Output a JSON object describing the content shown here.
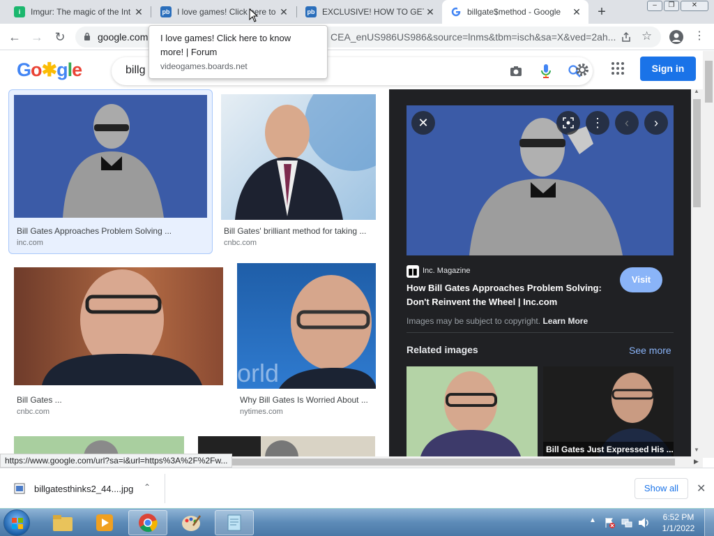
{
  "tabs": [
    {
      "label": "Imgur: The magic of the Int",
      "favicon": "imgur-icon"
    },
    {
      "label": "I love games! Click here to",
      "favicon": "proboards-icon"
    },
    {
      "label": "EXCLUSIVE! HOW TO GET F",
      "favicon": "proboards-icon"
    },
    {
      "label": "billgate$method - Google",
      "favicon": "google-icon",
      "active": true
    }
  ],
  "omnibox": {
    "host": "google.com",
    "tail": "CEA_enUS986US986&source=lnms&tbm=isch&sa=X&ved=2ah..."
  },
  "tooltip": {
    "title": "I love games! Click here to know more! | Forum",
    "host": "videogames.boards.net"
  },
  "header": {
    "logo_text": "Google",
    "query": "billg",
    "signin_label": "Sign in"
  },
  "results": [
    {
      "title": "Bill Gates Approaches Problem Solving ...",
      "source": "inc.com",
      "selected": true
    },
    {
      "title": "Bill Gates' brilliant method for taking ...",
      "source": "cnbc.com"
    },
    {
      "title": "Bill Gates ...",
      "source": "cnbc.com"
    },
    {
      "title": "Why Bill Gates Is Worried About ...",
      "source": "nytimes.com"
    }
  ],
  "panel": {
    "publisher": "Inc. Magazine",
    "title": "How Bill Gates Approaches Problem Solving: Don't Reinvent the Wheel | Inc.com",
    "visit_label": "Visit",
    "copyright": "Images may be subject to copyright.",
    "learn_more": "Learn More",
    "related_heading": "Related images",
    "see_more": "See more",
    "related_caption": "Bill Gates Just Expressed His ..."
  },
  "status_url": "https://www.google.com/url?sa=i&url=https%3A%2F%2Fw...",
  "download": {
    "filename": "billgatesthinks2_44....jpg",
    "show_all": "Show all"
  },
  "taskbar": {
    "time": "6:52 PM",
    "date": "1/1/2022"
  },
  "colors": {
    "accent": "#1a73e8",
    "panel_bg": "#202124",
    "visit_btn": "#8ab4f8",
    "thumb_blue": "#3b5ba7"
  }
}
